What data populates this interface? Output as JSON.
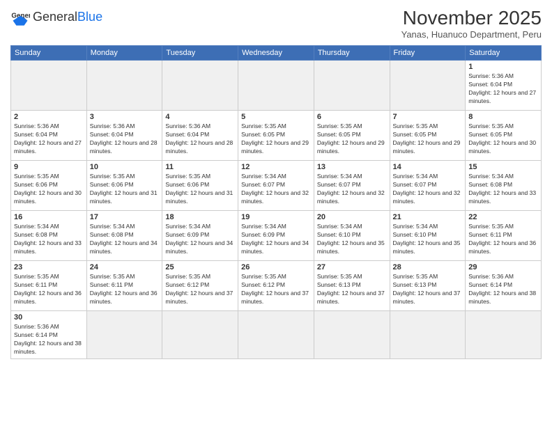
{
  "header": {
    "logo": {
      "general": "General",
      "blue": "Blue"
    },
    "title": "November 2025",
    "subtitle": "Yanas, Huanuco Department, Peru"
  },
  "weekdays": [
    "Sunday",
    "Monday",
    "Tuesday",
    "Wednesday",
    "Thursday",
    "Friday",
    "Saturday"
  ],
  "weeks": [
    [
      {
        "day": null,
        "info": null,
        "empty": true
      },
      {
        "day": null,
        "info": null,
        "empty": true
      },
      {
        "day": null,
        "info": null,
        "empty": true
      },
      {
        "day": null,
        "info": null,
        "empty": true
      },
      {
        "day": null,
        "info": null,
        "empty": true
      },
      {
        "day": null,
        "info": null,
        "empty": true
      },
      {
        "day": "1",
        "info": "Sunrise: 5:36 AM\nSunset: 6:04 PM\nDaylight: 12 hours and 27 minutes."
      }
    ],
    [
      {
        "day": "2",
        "info": "Sunrise: 5:36 AM\nSunset: 6:04 PM\nDaylight: 12 hours and 27 minutes."
      },
      {
        "day": "3",
        "info": "Sunrise: 5:36 AM\nSunset: 6:04 PM\nDaylight: 12 hours and 28 minutes."
      },
      {
        "day": "4",
        "info": "Sunrise: 5:36 AM\nSunset: 6:04 PM\nDaylight: 12 hours and 28 minutes."
      },
      {
        "day": "5",
        "info": "Sunrise: 5:35 AM\nSunset: 6:05 PM\nDaylight: 12 hours and 29 minutes."
      },
      {
        "day": "6",
        "info": "Sunrise: 5:35 AM\nSunset: 6:05 PM\nDaylight: 12 hours and 29 minutes."
      },
      {
        "day": "7",
        "info": "Sunrise: 5:35 AM\nSunset: 6:05 PM\nDaylight: 12 hours and 29 minutes."
      },
      {
        "day": "8",
        "info": "Sunrise: 5:35 AM\nSunset: 6:05 PM\nDaylight: 12 hours and 30 minutes."
      }
    ],
    [
      {
        "day": "9",
        "info": "Sunrise: 5:35 AM\nSunset: 6:06 PM\nDaylight: 12 hours and 30 minutes."
      },
      {
        "day": "10",
        "info": "Sunrise: 5:35 AM\nSunset: 6:06 PM\nDaylight: 12 hours and 31 minutes."
      },
      {
        "day": "11",
        "info": "Sunrise: 5:35 AM\nSunset: 6:06 PM\nDaylight: 12 hours and 31 minutes."
      },
      {
        "day": "12",
        "info": "Sunrise: 5:34 AM\nSunset: 6:07 PM\nDaylight: 12 hours and 32 minutes."
      },
      {
        "day": "13",
        "info": "Sunrise: 5:34 AM\nSunset: 6:07 PM\nDaylight: 12 hours and 32 minutes."
      },
      {
        "day": "14",
        "info": "Sunrise: 5:34 AM\nSunset: 6:07 PM\nDaylight: 12 hours and 32 minutes."
      },
      {
        "day": "15",
        "info": "Sunrise: 5:34 AM\nSunset: 6:08 PM\nDaylight: 12 hours and 33 minutes."
      }
    ],
    [
      {
        "day": "16",
        "info": "Sunrise: 5:34 AM\nSunset: 6:08 PM\nDaylight: 12 hours and 33 minutes."
      },
      {
        "day": "17",
        "info": "Sunrise: 5:34 AM\nSunset: 6:08 PM\nDaylight: 12 hours and 34 minutes."
      },
      {
        "day": "18",
        "info": "Sunrise: 5:34 AM\nSunset: 6:09 PM\nDaylight: 12 hours and 34 minutes."
      },
      {
        "day": "19",
        "info": "Sunrise: 5:34 AM\nSunset: 6:09 PM\nDaylight: 12 hours and 34 minutes."
      },
      {
        "day": "20",
        "info": "Sunrise: 5:34 AM\nSunset: 6:10 PM\nDaylight: 12 hours and 35 minutes."
      },
      {
        "day": "21",
        "info": "Sunrise: 5:34 AM\nSunset: 6:10 PM\nDaylight: 12 hours and 35 minutes."
      },
      {
        "day": "22",
        "info": "Sunrise: 5:35 AM\nSunset: 6:11 PM\nDaylight: 12 hours and 36 minutes."
      }
    ],
    [
      {
        "day": "23",
        "info": "Sunrise: 5:35 AM\nSunset: 6:11 PM\nDaylight: 12 hours and 36 minutes."
      },
      {
        "day": "24",
        "info": "Sunrise: 5:35 AM\nSunset: 6:11 PM\nDaylight: 12 hours and 36 minutes."
      },
      {
        "day": "25",
        "info": "Sunrise: 5:35 AM\nSunset: 6:12 PM\nDaylight: 12 hours and 37 minutes."
      },
      {
        "day": "26",
        "info": "Sunrise: 5:35 AM\nSunset: 6:12 PM\nDaylight: 12 hours and 37 minutes."
      },
      {
        "day": "27",
        "info": "Sunrise: 5:35 AM\nSunset: 6:13 PM\nDaylight: 12 hours and 37 minutes."
      },
      {
        "day": "28",
        "info": "Sunrise: 5:35 AM\nSunset: 6:13 PM\nDaylight: 12 hours and 37 minutes."
      },
      {
        "day": "29",
        "info": "Sunrise: 5:36 AM\nSunset: 6:14 PM\nDaylight: 12 hours and 38 minutes."
      }
    ],
    [
      {
        "day": "30",
        "info": "Sunrise: 5:36 AM\nSunset: 6:14 PM\nDaylight: 12 hours and 38 minutes."
      },
      {
        "day": null,
        "info": null,
        "empty": true
      },
      {
        "day": null,
        "info": null,
        "empty": true
      },
      {
        "day": null,
        "info": null,
        "empty": true
      },
      {
        "day": null,
        "info": null,
        "empty": true
      },
      {
        "day": null,
        "info": null,
        "empty": true
      },
      {
        "day": null,
        "info": null,
        "empty": true
      }
    ]
  ]
}
